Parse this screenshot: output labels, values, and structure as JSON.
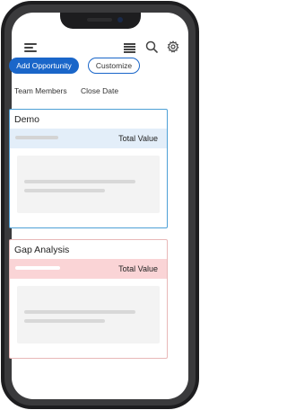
{
  "toolbar": {
    "add_label": "Add Opportunity",
    "customize_label": "Customize"
  },
  "filters": [
    "Team Members",
    "Close Date"
  ],
  "cards": [
    {
      "title": "Demo",
      "value_label": "Total Value",
      "accent": "#4ea0d6"
    },
    {
      "title": "Gap Analysis",
      "value_label": "Total Value",
      "accent": "#e8b8b8"
    }
  ],
  "colors": {
    "primary": "#1a66c9",
    "demo_band": "#e3eef9",
    "gap_band": "#fad4d6"
  },
  "icons": [
    "hamburger-menu-icon",
    "list-view-icon",
    "search-icon",
    "gear-icon"
  ]
}
